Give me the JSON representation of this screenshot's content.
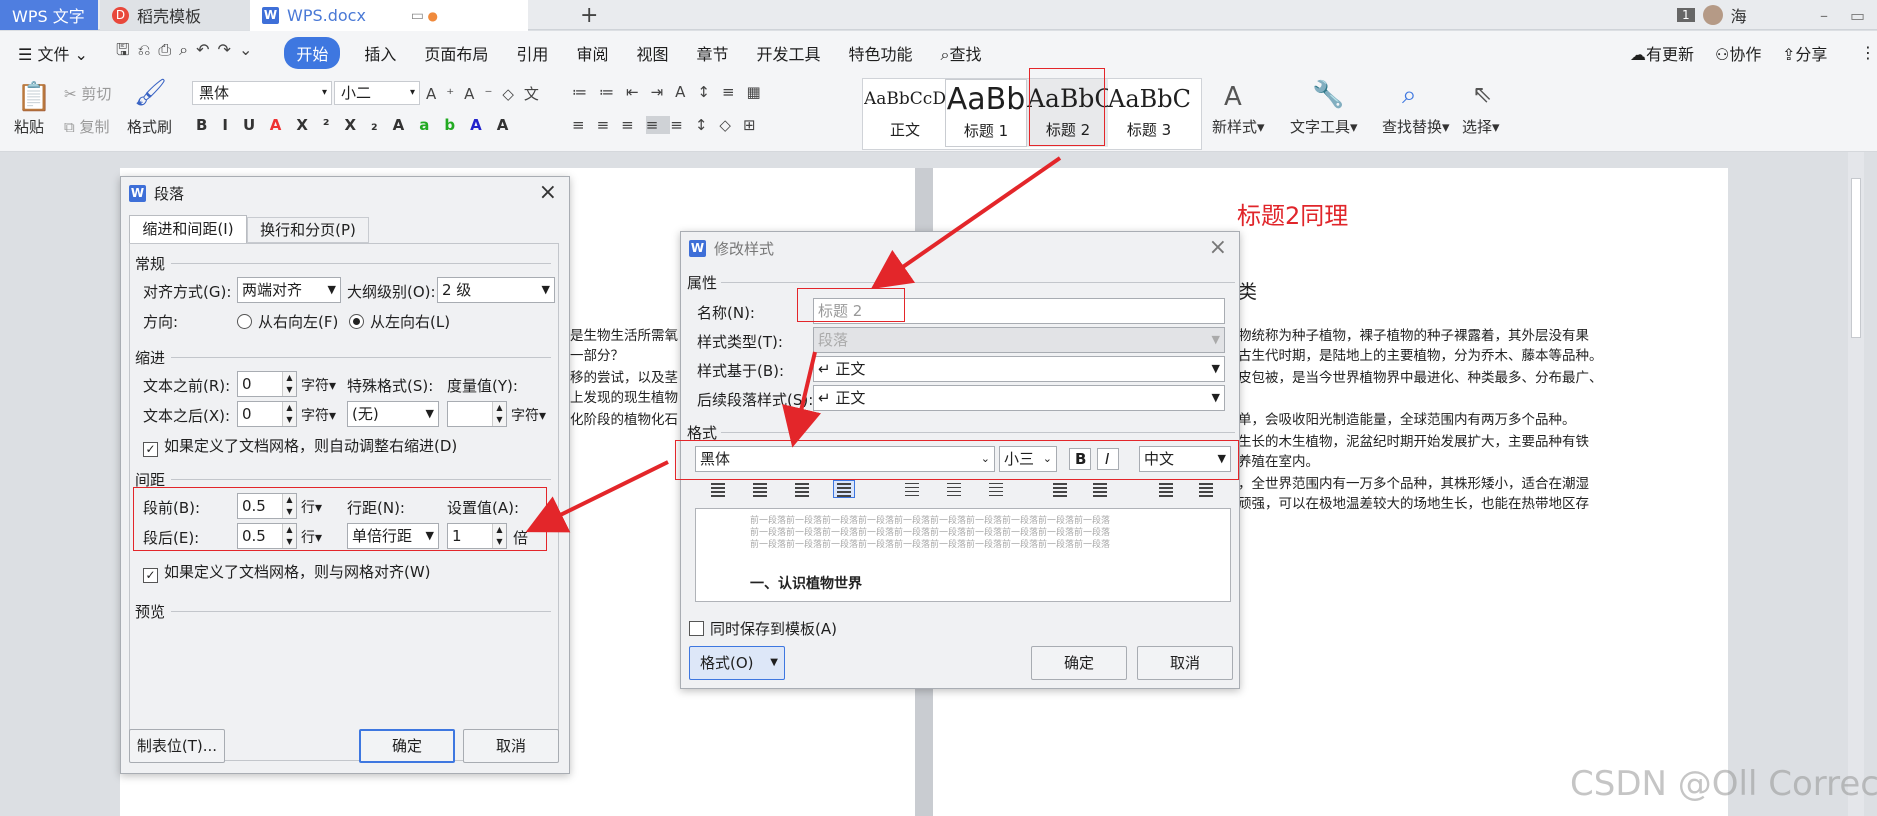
{
  "tabs": {
    "home": "WPS 文字",
    "template": "稻壳模板",
    "doc": "WPS.docx"
  },
  "titlebar": {
    "badge": "1",
    "user": "海"
  },
  "menu": {
    "file": "文件",
    "items": [
      "开始",
      "插入",
      "页面布局",
      "引用",
      "审阅",
      "视图",
      "章节",
      "开发工具",
      "特色功能"
    ],
    "search": "查找",
    "update": "有更新",
    "collab": "协作",
    "share": "分享"
  },
  "ribbon": {
    "paste": "粘贴",
    "cut": "剪切",
    "copy": "复制",
    "painter": "格式刷",
    "font": "黑体",
    "size": "小二",
    "styles": [
      {
        "sample": "AaBbCcDd",
        "label": "正文"
      },
      {
        "sample": "AaBb",
        "label": "标题 1"
      },
      {
        "sample": "AaBbC",
        "label": "标题 2"
      },
      {
        "sample": "AaBbC",
        "label": "标题 3"
      }
    ],
    "new_style": "新样式",
    "text_tools": "文字工具",
    "find_replace": "查找替换",
    "select": "选择"
  },
  "document": {
    "annotation": "标题2同理",
    "heading_tail": "类",
    "left_lines": [
      "是生物生活所需氧",
      "一部分？",
      "移的尝试，以及茎",
      "上发现的现生植物",
      "化阶段的植物化石"
    ],
    "right_lines": [
      "物统称为种子植物，裸子植物的种子裸露着，其外层没有果",
      "古生代时期，是陆地上的主要植物，分为乔木、藤本等品种。",
      "皮包被，是当今世界植物界中最进化、种类最多、分布最广、",
      "",
      "单，会吸收阳光制造能量，全球范围内有两万多个品种。",
      "生长的木生植物，泥盆纪时期开始发展扩大，主要品种有铁",
      "养殖在室内。",
      "，全世界范围内有一万多个品种，其株形矮小，适合在潮湿",
      "顽强，可以在极地温差较大的场地生长，也能在热带地区存"
    ]
  },
  "para_dialog": {
    "title": "段落",
    "tab_indent": "缩进和间距(I)",
    "tab_break": "换行和分页(P)",
    "sec_general": "常规",
    "align_label": "对齐方式(G):",
    "align_value": "两端对齐",
    "outline_label": "大纲级别(O):",
    "outline_value": "2 级",
    "direction_label": "方向:",
    "rtl": "从右向左(F)",
    "ltr": "从左向右(L)",
    "sec_indent": "缩进",
    "before_text": "文本之前(R):",
    "before_text_value": "0",
    "after_text": "文本之后(X):",
    "after_text_value": "0",
    "unit_char": "字符",
    "special_label": "特殊格式(S):",
    "special_value": "(无)",
    "measure_label": "度量值(Y):",
    "grid_indent": "如果定义了文档网格，则自动调整右缩进(D)",
    "sec_spacing": "间距",
    "before_label": "段前(B):",
    "before_value": "0.5",
    "unit_line": "行",
    "line_label": "行距(N):",
    "line_value": "单倍行距",
    "set_label": "设置值(A):",
    "set_value": "1",
    "unit_times": "倍",
    "after_label": "段后(E):",
    "after_value": "0.5",
    "grid_align": "如果定义了文档网格，则与网格对齐(W)",
    "sec_preview": "预览",
    "tabs_btn": "制表位(T)...",
    "ok": "确定",
    "cancel": "取消"
  },
  "style_dialog": {
    "title": "修改样式",
    "sec_props": "属性",
    "name_label": "名称(N):",
    "name_value": "标题 2",
    "type_label": "样式类型(T):",
    "type_value": "段落",
    "based_label": "样式基于(B):",
    "based_value": "↵ 正文",
    "next_label": "后续段落样式(S):",
    "next_value": "↵ 正文",
    "sec_format": "格式",
    "font": "黑体",
    "size": "小三",
    "bold": "B",
    "italic": "I",
    "lang": "中文",
    "preview_prev": "前一段落前一段落前一段落前一段落前一段落前一段落前一段落前一段落前一段落前一段落",
    "preview_head": "一、认识植物世界",
    "save_template": "同时保存到模板(A)",
    "format_btn": "格式(O)",
    "ok": "确定",
    "cancel": "取消"
  },
  "watermark": "CSDN @Oll Correct"
}
